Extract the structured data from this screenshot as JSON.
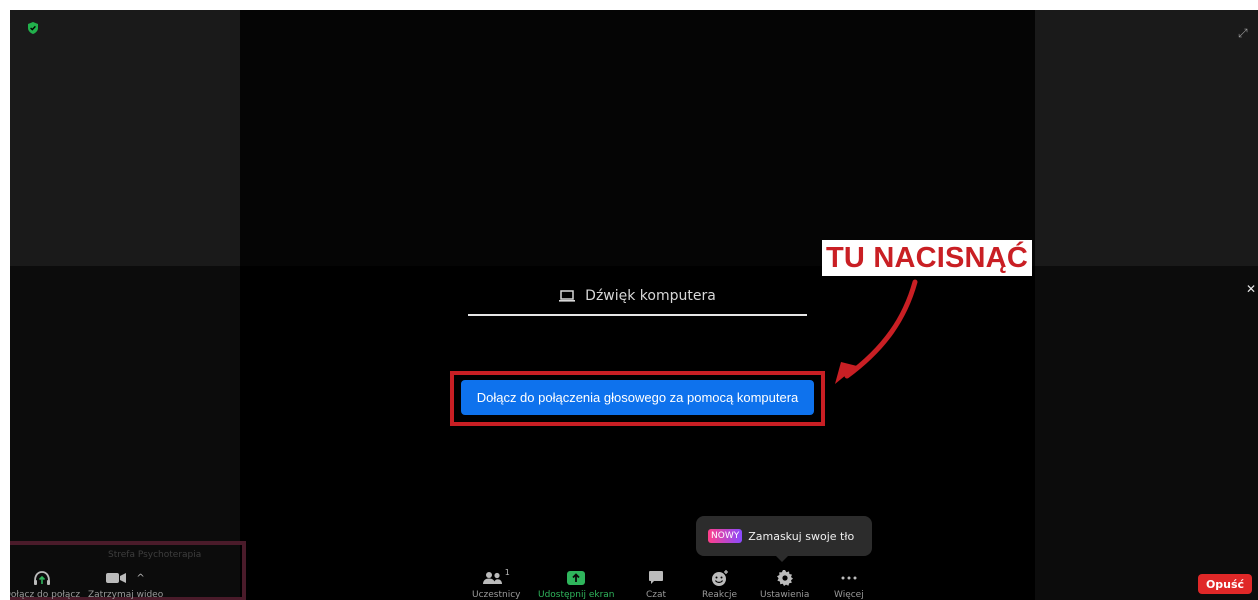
{
  "audio": {
    "tab_label": "Dźwięk komputera",
    "join_button": "Dołącz do połączenia głosowego za pomocą komputera"
  },
  "annotation": {
    "label": "TU NACISNĄĆ",
    "color": "#c91f24"
  },
  "tooltip": {
    "badge": "NOWY",
    "text": "Zamaskuj swoje tło"
  },
  "host": {
    "name": "Strefa Psychoterapia"
  },
  "toolbar": {
    "join_audio": "Dołącz do połącz",
    "stop_video": "Zatrzymaj wideo",
    "participants": "Uczestnicy",
    "participants_count": "1",
    "share_screen": "Udostępnij ekran",
    "chat": "Czat",
    "reactions": "Reakcje",
    "settings": "Ustawienia",
    "more": "Więcej",
    "leave": "Opuść"
  },
  "colors": {
    "accent_blue": "#0e72ed",
    "share_green": "#2fb55c",
    "leave_red": "#e02828"
  }
}
